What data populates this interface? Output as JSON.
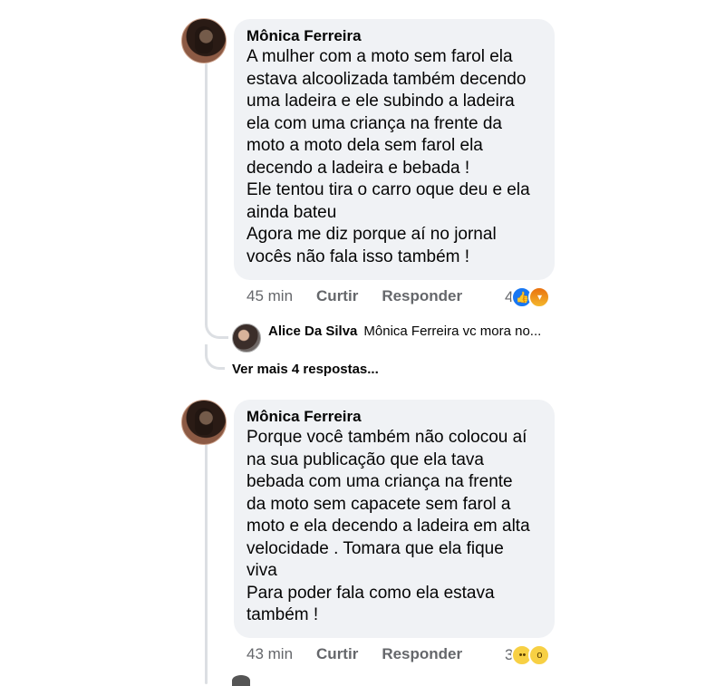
{
  "comments": [
    {
      "author": "Mônica Ferreira",
      "lines": [
        "A mulher com a moto sem farol ela",
        "estava alcoolizada também decendo",
        "uma ladeira e ele subindo a ladeira",
        "ela com uma criança na frente da",
        "moto a moto dela sem farol ela",
        "decendo a ladeira e bebada !",
        "Ele tentou tira o carro oque deu e ela",
        "ainda bateu",
        "Agora me diz porque aí no jornal",
        "vocês não fala isso também !"
      ],
      "time": "45 min",
      "like_label": "Curtir",
      "reply_label": "Responder",
      "reaction_count": "4",
      "reactions": [
        "like-icon",
        "angry-icon"
      ]
    },
    {
      "author": "Mônica Ferreira",
      "lines": [
        "Porque você também não colocou aí",
        "na sua publicação que ela tava",
        "bebada com uma criança na frente",
        "da moto sem capacete sem farol a",
        "moto e ela decendo a ladeira em alta",
        "velocidade . Tomara que ela fique",
        "viva",
        "Para poder fala como ela estava",
        "também !"
      ],
      "time": "43 min",
      "like_label": "Curtir",
      "reply_label": "Responder",
      "reaction_count": "3",
      "reactions": [
        "sad-icon",
        "wow-icon"
      ]
    }
  ],
  "reply_preview": {
    "author": "Alice Da Silva",
    "text": "Mônica Ferreira vc mora no..."
  },
  "more_replies_label": "Ver mais 4 respostas...",
  "colors": {
    "bubble": "#f0f2f5",
    "meta_text": "#65676b",
    "like_blue": "#1877f2",
    "thread_line": "#dcdfe3"
  }
}
